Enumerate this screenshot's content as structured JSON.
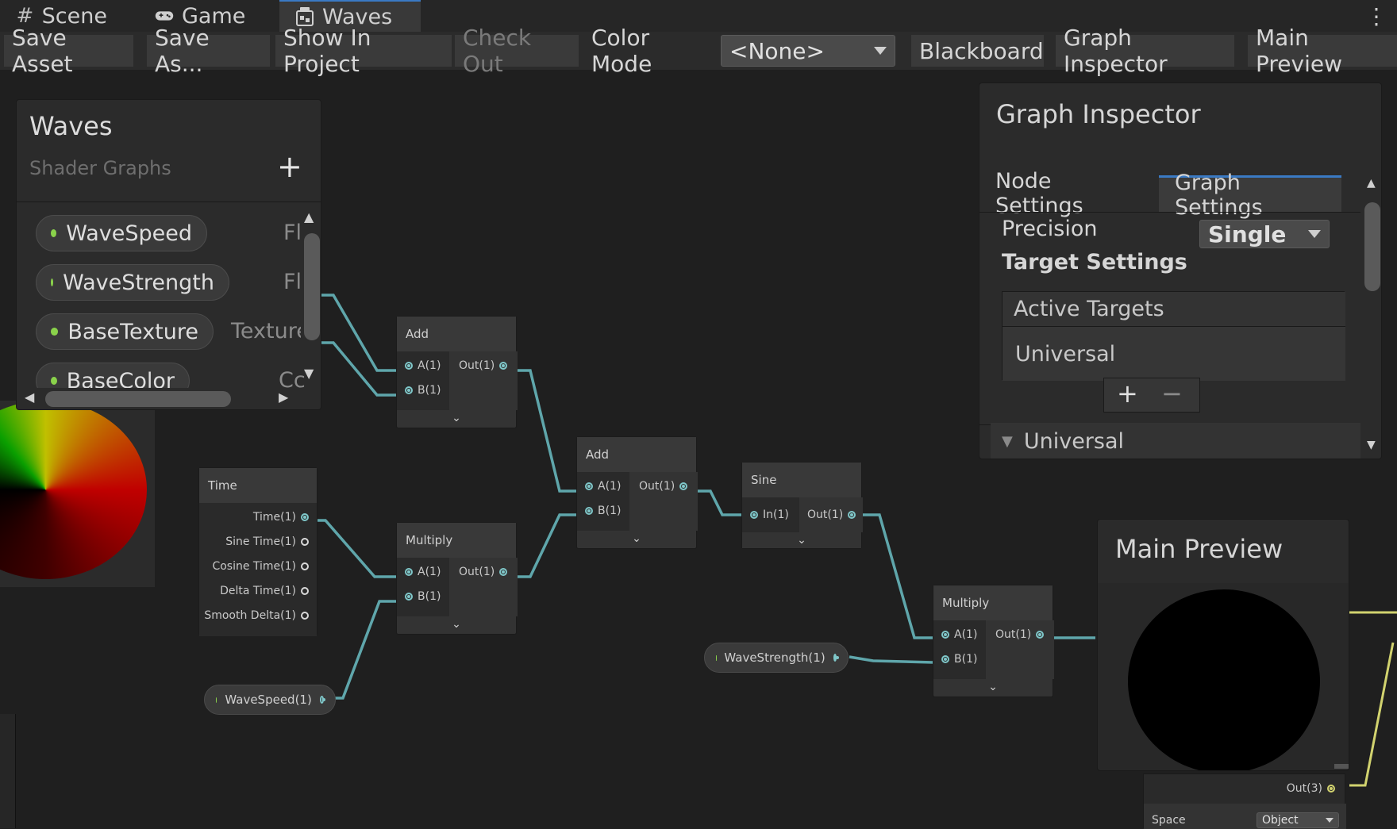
{
  "tabs": [
    {
      "label": "Scene",
      "icon": "hash-icon"
    },
    {
      "label": "Game",
      "icon": "gamepad-icon"
    },
    {
      "label": "Waves",
      "icon": "shadergraph-icon"
    }
  ],
  "toolbar": {
    "save_asset": "Save Asset",
    "save_as": "Save As...",
    "show_in_project": "Show In Project",
    "check_out": "Check Out",
    "color_mode_label": "Color Mode",
    "color_mode_value": "<None>",
    "blackboard": "Blackboard",
    "graph_inspector": "Graph Inspector",
    "main_preview": "Main Preview"
  },
  "blackboard": {
    "title": "Waves",
    "subtitle": "Shader Graphs",
    "add_symbol": "+",
    "properties": [
      {
        "name": "WaveSpeed",
        "type": "Fl"
      },
      {
        "name": "WaveStrength",
        "type": "Fl"
      },
      {
        "name": "BaseTexture",
        "type": "Texture"
      },
      {
        "name": "BaseColor",
        "type": "Cc"
      }
    ]
  },
  "nodes": {
    "add1": {
      "title": "Add",
      "in_a": "A(1)",
      "in_b": "B(1)",
      "out": "Out(1)"
    },
    "add2": {
      "title": "Add",
      "in_a": "A(1)",
      "in_b": "B(1)",
      "out": "Out(1)"
    },
    "time": {
      "title": "Time",
      "outputs": [
        "Time(1)",
        "Sine Time(1)",
        "Cosine Time(1)",
        "Delta Time(1)",
        "Smooth Delta(1)"
      ]
    },
    "multiply1": {
      "title": "Multiply",
      "in_a": "A(1)",
      "in_b": "B(1)",
      "out": "Out(1)"
    },
    "sine": {
      "title": "Sine",
      "in": "In(1)",
      "out": "Out(1)"
    },
    "multiply2": {
      "title": "Multiply",
      "in_a": "A(1)",
      "in_b": "B(1)",
      "out": "Out(1)"
    },
    "wavespeed_prop": "WaveSpeed(1)",
    "wavestrength_prop": "WaveStrength(1)"
  },
  "inspector": {
    "title": "Graph Inspector",
    "tab_node": "Node Settings",
    "tab_graph": "Graph Settings",
    "precision_label": "Precision",
    "precision_value": "Single",
    "target_settings": "Target Settings",
    "active_targets": "Active Targets",
    "target_item": "Universal",
    "add_symbol": "+",
    "remove_symbol": "−",
    "universal_section": "Universal"
  },
  "main_preview": {
    "title": "Main Preview"
  },
  "master": {
    "out_label": "Out(3)",
    "space_label": "Space",
    "space_value": "Object"
  },
  "colors": {
    "accent": "#3a7ac4",
    "wire": "#5fa6ab",
    "property_dot": "#8ad24b",
    "vector3_wire": "#d2d36f"
  }
}
